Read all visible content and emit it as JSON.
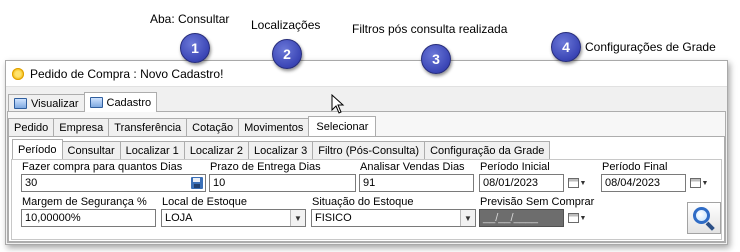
{
  "callouts": [
    {
      "number": "1",
      "label": "Aba: Consultar"
    },
    {
      "number": "2",
      "label": "Localizações"
    },
    {
      "number": "3",
      "label": "Filtros pós consulta realizada"
    },
    {
      "number": "4",
      "label": "Configurações de Grade"
    }
  ],
  "window": {
    "title": "Pedido de Compra  : Novo Cadastro!"
  },
  "top_tabs": [
    {
      "label": "Visualizar",
      "active": false
    },
    {
      "label": "Cadastro",
      "active": true
    }
  ],
  "second_tabs": [
    "Pedido",
    "Empresa",
    "Transferência",
    "Cotação",
    "Movimentos",
    "Selecionar"
  ],
  "third_tabs": [
    "Período",
    "Consultar",
    "Localizar 1",
    "Localizar 2",
    "Localizar 3",
    "Filtro (Pós-Consulta)",
    "Configuração da Grade"
  ],
  "form": {
    "dias_label": "Fazer compra para quantos Dias",
    "dias_value": "30",
    "prazo_label": "Prazo de Entrega Dias",
    "prazo_value": "10",
    "analisar_label": "Analisar Vendas Dias",
    "analisar_value": "91",
    "periodo_inicial_label": "Período Inicial",
    "periodo_inicial_value": "08/01/2023",
    "periodo_final_label": "Período Final",
    "periodo_final_value": "08/04/2023",
    "margem_label": "Margem de Segurança %",
    "margem_value": "10,00000%",
    "local_label": "Local de Estoque",
    "local_value": "LOJA",
    "situacao_label": "Situação do Estoque",
    "situacao_value": "FISICO",
    "previsao_label": "Previsão Sem Comprar",
    "previsao_value": "__/__/____"
  },
  "colors": {
    "badge": "#3a45b5",
    "accent_icon": "#2f6cc6"
  }
}
